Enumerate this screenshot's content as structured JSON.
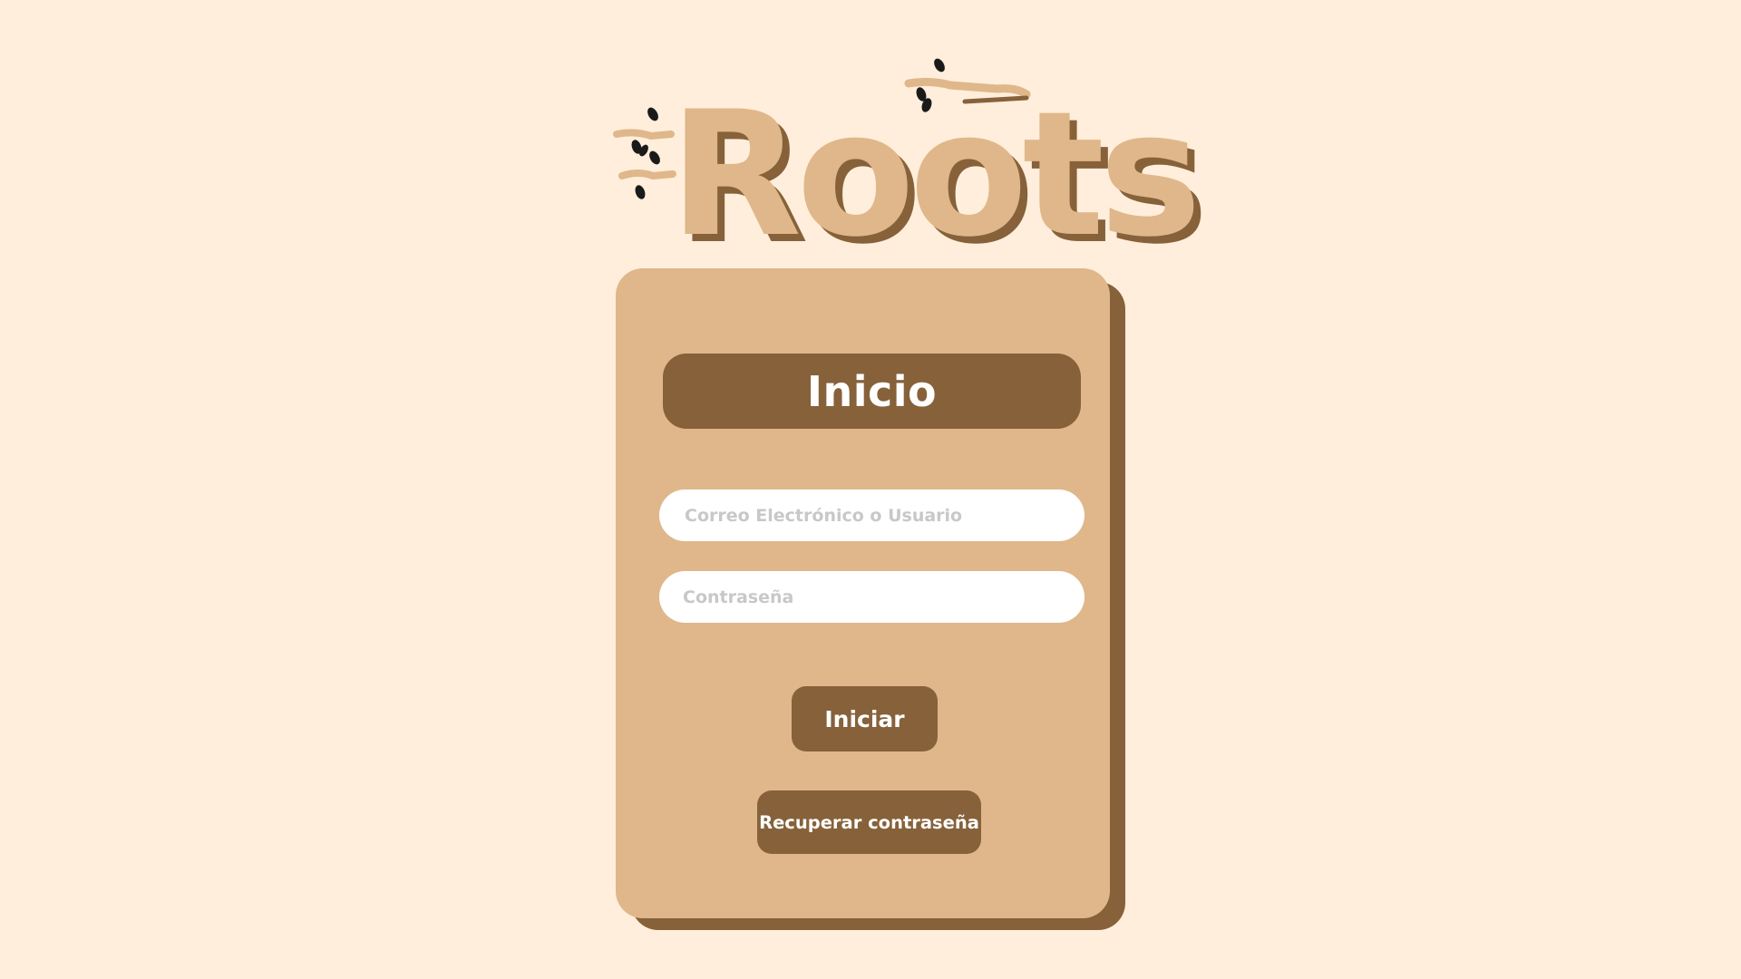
{
  "app": {
    "logo_text": "Roots",
    "colors": {
      "background": "#FFEEDB",
      "card": "#DFB78A",
      "accent": "#86613A",
      "logo_fill": "#DFB78A",
      "logo_shadow": "#86613A",
      "leaf": "#1A1A1A",
      "field": "#FFFFFF"
    }
  },
  "card": {
    "title": "Inicio",
    "fields": {
      "user": {
        "placeholder": "Correo Electrónico o Usuario",
        "value": ""
      },
      "password": {
        "placeholder": "Contraseña",
        "value": ""
      }
    },
    "buttons": {
      "login_label": "Iniciar",
      "recover_label": "Recuperar contraseña"
    }
  }
}
